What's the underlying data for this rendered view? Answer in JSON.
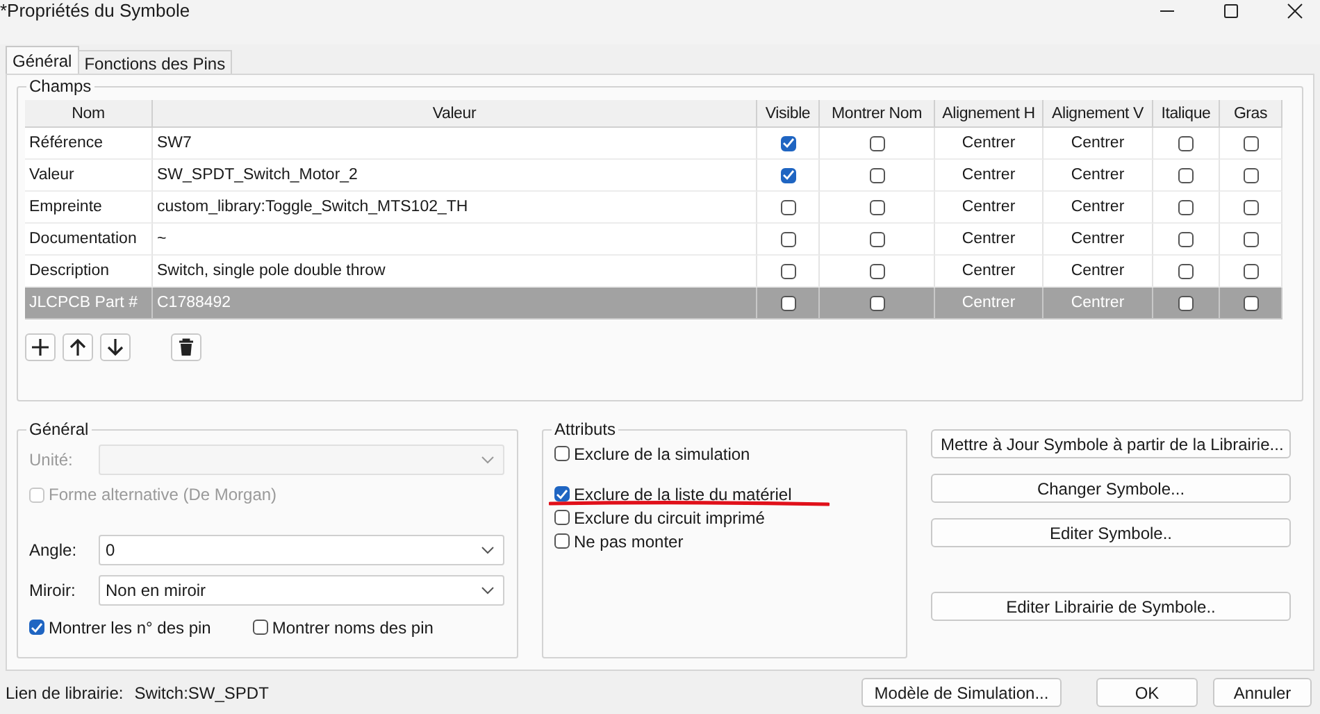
{
  "window": {
    "title": "*Propriétés du Symbole"
  },
  "tabs": [
    {
      "label": "Général",
      "selected": true
    },
    {
      "label": "Fonctions des Pins",
      "selected": false
    }
  ],
  "fields_group": {
    "title": "Champs",
    "columns": [
      "Nom",
      "Valeur",
      "Visible",
      "Montrer Nom",
      "Alignement H",
      "Alignement V",
      "Italique",
      "Gras"
    ],
    "rows": [
      {
        "name": "Référence",
        "value": "SW7",
        "visible": true,
        "show_name": false,
        "h_align": "Centrer",
        "v_align": "Centrer",
        "italic": false,
        "bold": false,
        "selected": false
      },
      {
        "name": "Valeur",
        "value": "SW_SPDT_Switch_Motor_2",
        "visible": true,
        "show_name": false,
        "h_align": "Centrer",
        "v_align": "Centrer",
        "italic": false,
        "bold": false,
        "selected": false
      },
      {
        "name": "Empreinte",
        "value": "custom_library:Toggle_Switch_MTS102_TH",
        "visible": false,
        "show_name": false,
        "h_align": "Centrer",
        "v_align": "Centrer",
        "italic": false,
        "bold": false,
        "selected": false
      },
      {
        "name": "Documentation",
        "value": "~",
        "visible": false,
        "show_name": false,
        "h_align": "Centrer",
        "v_align": "Centrer",
        "italic": false,
        "bold": false,
        "selected": false
      },
      {
        "name": "Description",
        "value": "Switch, single pole double throw",
        "visible": false,
        "show_name": false,
        "h_align": "Centrer",
        "v_align": "Centrer",
        "italic": false,
        "bold": false,
        "selected": false
      },
      {
        "name": "JLCPCB Part #",
        "value": "C1788492",
        "visible": false,
        "show_name": false,
        "h_align": "Centrer",
        "v_align": "Centrer",
        "italic": false,
        "bold": false,
        "selected": true
      }
    ],
    "toolbar": [
      {
        "kind": "add"
      },
      {
        "kind": "up"
      },
      {
        "kind": "down"
      },
      {
        "kind": "delete"
      }
    ]
  },
  "general_group": {
    "title": "Général",
    "unit": {
      "label": "Unité:",
      "disabled": true
    },
    "alternate": {
      "label": "Forme alternative (De Morgan)",
      "checked": false,
      "disabled": true
    },
    "angle": {
      "label": "Angle:",
      "value": "0",
      "disabled": false
    },
    "mirror": {
      "label": "Miroir:",
      "value": "Non en miroir",
      "disabled": false
    },
    "pin_options": [
      {
        "label": "Montrer les n° des pin",
        "checked": true
      },
      {
        "label": "Montrer noms des pin",
        "checked": false
      }
    ]
  },
  "attributes_group": {
    "title": "Attributs",
    "options": [
      {
        "label": "Exclure de la simulation",
        "checked": false,
        "underlined": false
      },
      {
        "label": "Exclure de la liste du matériel",
        "checked": true,
        "underlined": true
      },
      {
        "label": "Exclure du circuit imprimé",
        "checked": false,
        "underlined": false
      },
      {
        "label": "Ne pas monter",
        "checked": false,
        "underlined": false
      }
    ]
  },
  "side_buttons": [
    "Mettre à Jour Symbole à partir de la Librairie...",
    "Changer Symbole...",
    "Editer Symbole..",
    "Editer Librairie de Symbole.."
  ],
  "footer": {
    "library_label": "Lien de librairie:",
    "library_value": "Switch:SW_SPDT",
    "buttons": [
      "Modèle de Simulation...",
      "OK",
      "Annuler"
    ]
  }
}
